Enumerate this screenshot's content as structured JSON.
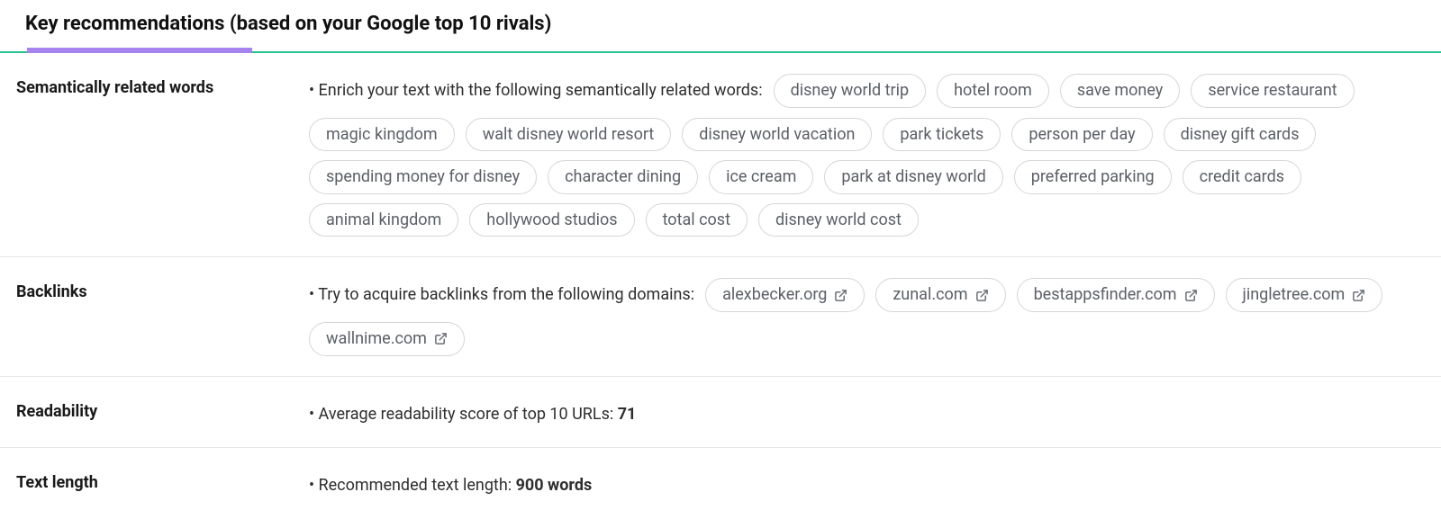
{
  "header": {
    "title": "Key recommendations (based on your Google top 10 rivals)"
  },
  "sections": {
    "semantic": {
      "label": "Semantically related words",
      "lead": "Enrich your text with the following semantically related words:",
      "words": [
        "disney world trip",
        "hotel room",
        "save money",
        "service restaurant",
        "magic kingdom",
        "walt disney world resort",
        "disney world vacation",
        "park tickets",
        "person per day",
        "disney gift cards",
        "spending money for disney",
        "character dining",
        "ice cream",
        "park at disney world",
        "preferred parking",
        "credit cards",
        "animal kingdom",
        "hollywood studios",
        "total cost",
        "disney world cost"
      ]
    },
    "backlinks": {
      "label": "Backlinks",
      "lead": "Try to acquire backlinks from the following domains:",
      "domains": [
        "alexbecker.org",
        "zunal.com",
        "bestappsfinder.com",
        "jingletree.com",
        "wallnime.com"
      ]
    },
    "readability": {
      "label": "Readability",
      "lead": "Average readability score of top 10 URLs: ",
      "value": "71"
    },
    "textlength": {
      "label": "Text length",
      "lead": "Recommended text length: ",
      "value": "900 words"
    }
  }
}
